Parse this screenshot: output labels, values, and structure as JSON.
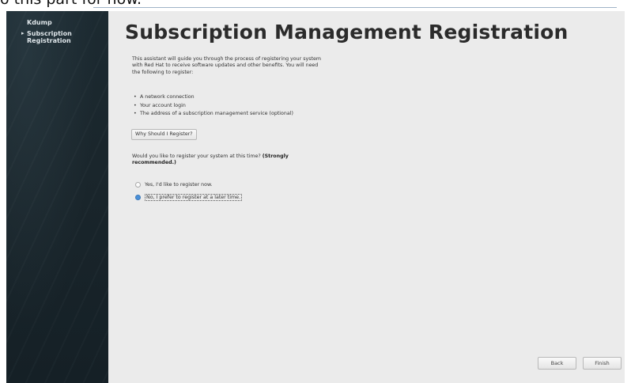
{
  "caption": "o this part for now.",
  "sidebar": {
    "items": [
      {
        "label": "Kdump",
        "current": false
      },
      {
        "label": "Subscription Registration",
        "current": true,
        "marker": "▸"
      }
    ]
  },
  "page": {
    "title": "Subscription Management Registration",
    "intro": "This assistant will guide you through the process of registering your system with Red Hat to receive software updates and other benefits. You will need the following to register:",
    "requirements": [
      "A network connection",
      "Your account login",
      "The address of a subscription management service (optional)"
    ],
    "bullet": "•",
    "why_button": "Why Should I Register?",
    "question_text": "Would you like to register your system at this time?",
    "question_emphasis": "(Strongly recommended.)",
    "options": [
      {
        "label": "Yes, I'd like to register now.",
        "selected": false
      },
      {
        "label": "No, I prefer to register at a later time.",
        "selected": true
      }
    ]
  },
  "footer": {
    "back_label": "Back",
    "finish_label": "Finish"
  },
  "colors": {
    "sidebar_bg": "#1c2a31",
    "content_bg": "#ebebeb",
    "radio_selected": "#4a90d9"
  }
}
